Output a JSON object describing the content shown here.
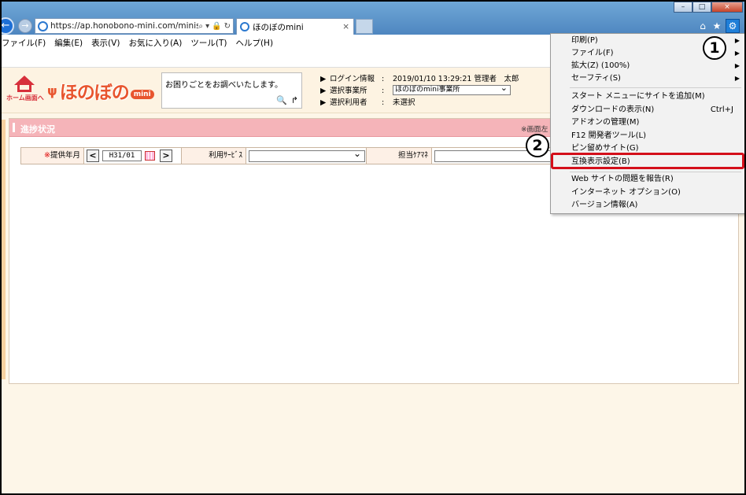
{
  "browser": {
    "url": "https://ap.honobono-mini.com/minisv/MN",
    "tab_title": "ほのぼのmini",
    "address_icons": [
      "⌕ ▾",
      "🔒",
      "↻"
    ],
    "tab_close": "×",
    "window_buttons": [
      "–",
      "□",
      "×"
    ],
    "toolbar_icons": [
      "⌂",
      "★",
      "⚙"
    ]
  },
  "menubar": [
    "ファイル(F)",
    "編集(E)",
    "表示(V)",
    "お気に入り(A)",
    "ツール(T)",
    "ヘルプ(H)"
  ],
  "header": {
    "home_label": "ホーム画面へ",
    "logo_text": "ほのぼの",
    "logo_badge": "mini",
    "search_prompt": "お困りごとをお調べいたします。",
    "login": {
      "login_label": "ログイン情報",
      "login_value": "2019/01/10 13:29:21  管理者　太郎",
      "office_label": "選択事業所",
      "office_value": "ほのぼのmini事業所",
      "user_label": "選択利用者",
      "user_value": "未選択"
    }
  },
  "panel": {
    "title": "進捗状況",
    "note": "※画面左",
    "filters": {
      "year_month_label": "提供年月",
      "required_mark": "※",
      "year_month_value": "H31/01",
      "service_label": "利用ｻｰﾋﾞｽ",
      "caremanager_label": "担当ｹｱﾏﾈ"
    }
  },
  "ie_menu": {
    "items": [
      {
        "label": "印刷(P)",
        "submenu": true
      },
      {
        "label": "ファイル(F)",
        "submenu": true
      },
      {
        "label": "拡大(Z) (100%)",
        "submenu": true
      },
      {
        "label": "セーフティ(S)",
        "submenu": true
      },
      {
        "label": "スタート メニューにサイトを追加(M)"
      },
      {
        "label": "ダウンロードの表示(N)",
        "shortcut": "Ctrl+J"
      },
      {
        "label": "アドオンの管理(M)"
      },
      {
        "label": "F12 開発者ツール(L)"
      },
      {
        "label": "ピン留めサイト(G)"
      },
      {
        "label": "互換表示設定(B)"
      },
      {
        "label": "Web サイトの問題を報告(R)"
      },
      {
        "label": "インターネット オプション(O)"
      },
      {
        "label": "バージョン情報(A)"
      }
    ]
  },
  "callouts": {
    "one": "1",
    "two": "2"
  },
  "colors": {
    "highlight": "#d40f1a",
    "panel_header": "#f5b4b9",
    "ie_blue": "#1f7fd8"
  }
}
